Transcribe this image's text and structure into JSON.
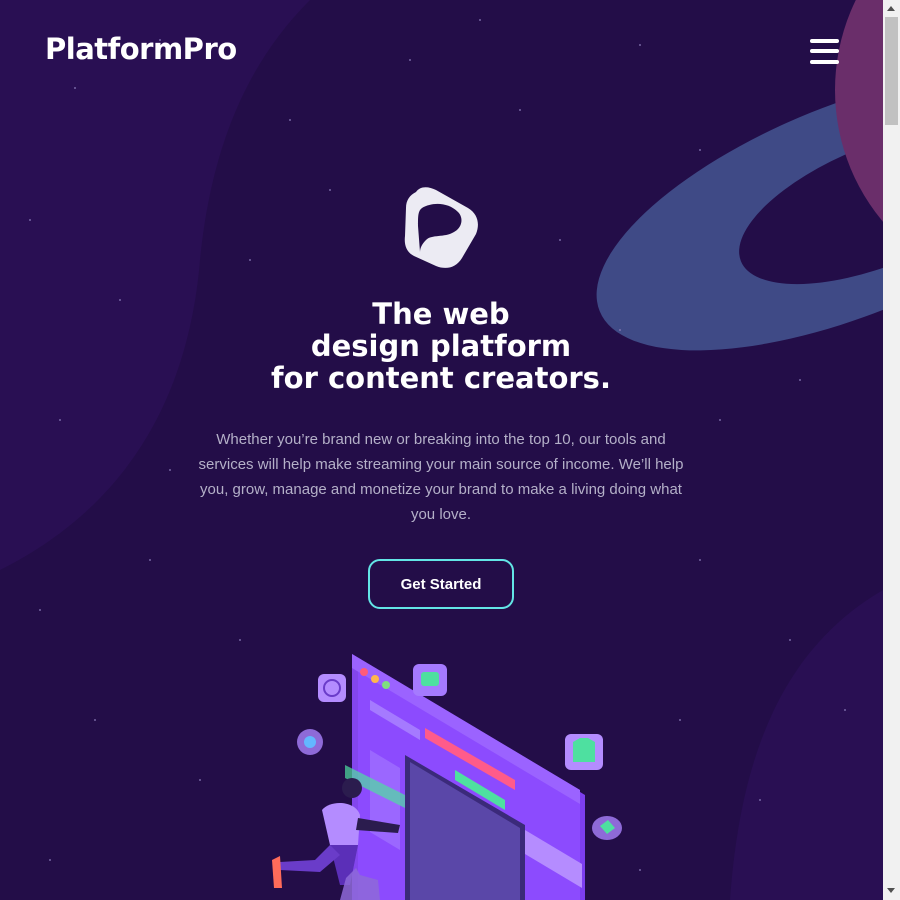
{
  "header": {
    "brand": "PlatformPro",
    "menu_icon": "hamburger-menu-icon"
  },
  "hero": {
    "logo_icon": "platformpro-logo-icon",
    "title_lines": [
      "The web",
      "design platform",
      "for content creators."
    ],
    "description": "Whether you’re brand new or breaking into the top 10, our tools and services will help make streaming your main source of income. We’ll help you, grow, manage and monetize your brand to make a living doing what you love.",
    "cta_label": "Get Started",
    "illustration": "streamer-isometric-illustration"
  },
  "colors": {
    "background": "#230d48",
    "accent_ring": "#3f4a86",
    "planet": "#6a2e6a",
    "cta_border": "#63e5e6",
    "text": "#ffffff",
    "muted_text": "#b4b0c8"
  }
}
